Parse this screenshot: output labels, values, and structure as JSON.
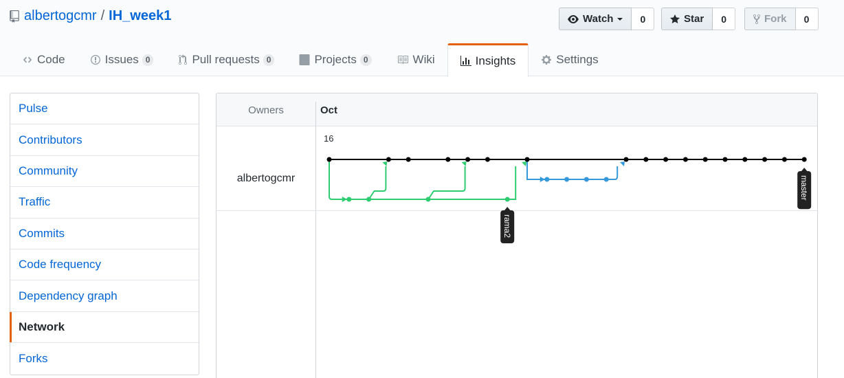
{
  "repo": {
    "owner": "albertogcmr",
    "separator": "/",
    "name": "IH_week1"
  },
  "actions": {
    "watch": {
      "label": "Watch",
      "count": "0"
    },
    "star": {
      "label": "Star",
      "count": "0"
    },
    "fork": {
      "label": "Fork",
      "count": "0"
    }
  },
  "tabs": [
    {
      "label": "Code",
      "icon": "code-icon"
    },
    {
      "label": "Issues",
      "icon": "issue-icon",
      "count": "0"
    },
    {
      "label": "Pull requests",
      "icon": "pull-request-icon",
      "count": "0"
    },
    {
      "label": "Projects",
      "icon": "project-icon",
      "count": "0"
    },
    {
      "label": "Wiki",
      "icon": "book-icon"
    },
    {
      "label": "Insights",
      "icon": "graph-icon",
      "selected": true
    },
    {
      "label": "Settings",
      "icon": "gear-icon"
    }
  ],
  "menu": [
    {
      "label": "Pulse"
    },
    {
      "label": "Contributors"
    },
    {
      "label": "Community"
    },
    {
      "label": "Traffic"
    },
    {
      "label": "Commits"
    },
    {
      "label": "Code frequency"
    },
    {
      "label": "Dependency graph"
    },
    {
      "label": "Network",
      "selected": true
    },
    {
      "label": "Forks"
    }
  ],
  "network": {
    "owners_label": "Owners",
    "month": "Oct",
    "day": "16",
    "owner": "albertogcmr",
    "branches": {
      "master": {
        "label": "master",
        "color": "#000000"
      },
      "rama2": {
        "label": "rama2",
        "color": "#2ecc71"
      },
      "blue": {
        "label": "",
        "color": "#3498db"
      }
    },
    "commit_columns": {
      "master": [
        0,
        3,
        4,
        6,
        7,
        8,
        10,
        15,
        16,
        17,
        18,
        19,
        20,
        21,
        22,
        23,
        24
      ],
      "green": [
        1,
        2,
        5,
        9
      ],
      "blue": [
        11,
        12,
        13,
        14
      ]
    }
  },
  "colors": {
    "link": "#0366d6",
    "accent": "#e36209"
  }
}
